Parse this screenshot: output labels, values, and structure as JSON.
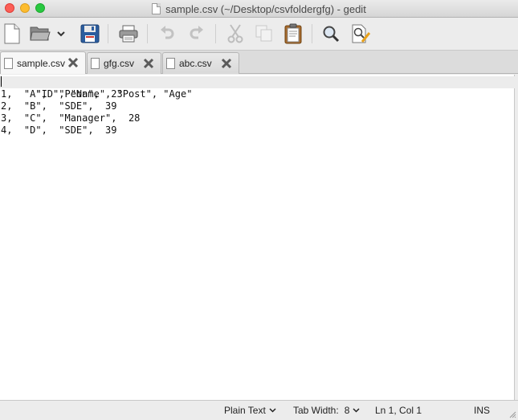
{
  "window": {
    "title": "sample.csv (~/Desktop/csvfoldergfg) - gedit"
  },
  "toolbar": {
    "buttons": [
      {
        "name": "new-document",
        "icon": "new-document-icon"
      },
      {
        "name": "open",
        "icon": "folder-open-icon"
      },
      {
        "name": "open-recent",
        "icon": "chevron-down-icon"
      },
      {
        "name": "save",
        "icon": "floppy-disk-icon"
      },
      {
        "name": "print",
        "icon": "printer-icon"
      },
      {
        "name": "undo",
        "icon": "undo-icon"
      },
      {
        "name": "redo",
        "icon": "redo-icon"
      },
      {
        "name": "cut",
        "icon": "scissors-icon"
      },
      {
        "name": "copy",
        "icon": "copy-icon"
      },
      {
        "name": "paste",
        "icon": "clipboard-icon"
      },
      {
        "name": "find",
        "icon": "magnifier-icon"
      },
      {
        "name": "replace",
        "icon": "find-replace-icon"
      }
    ]
  },
  "tabs": [
    {
      "label": "sample.csv",
      "active": true
    },
    {
      "label": "gfg.csv",
      "active": false
    },
    {
      "label": "abc.csv",
      "active": false
    }
  ],
  "editor": {
    "lines": [
      "\"ID\", \"Name\", \"Post\", \"Age\"",
      "1,  \"A\",  \"Peon\",  23",
      "2,  \"B\",  \"SDE\",  39",
      "3,  \"C\",  \"Manager\",  28",
      "4,  \"D\",  \"SDE\",  39"
    ]
  },
  "status": {
    "language": "Plain Text",
    "tab_width_label": "Tab Width:",
    "tab_width_value": "8",
    "position": "Ln 1, Col 1",
    "mode": "INS"
  },
  "colors": {
    "close": "#fc5f57",
    "minimize": "#fdbc2e",
    "maximize": "#28c840",
    "current_line": "#ececec"
  }
}
